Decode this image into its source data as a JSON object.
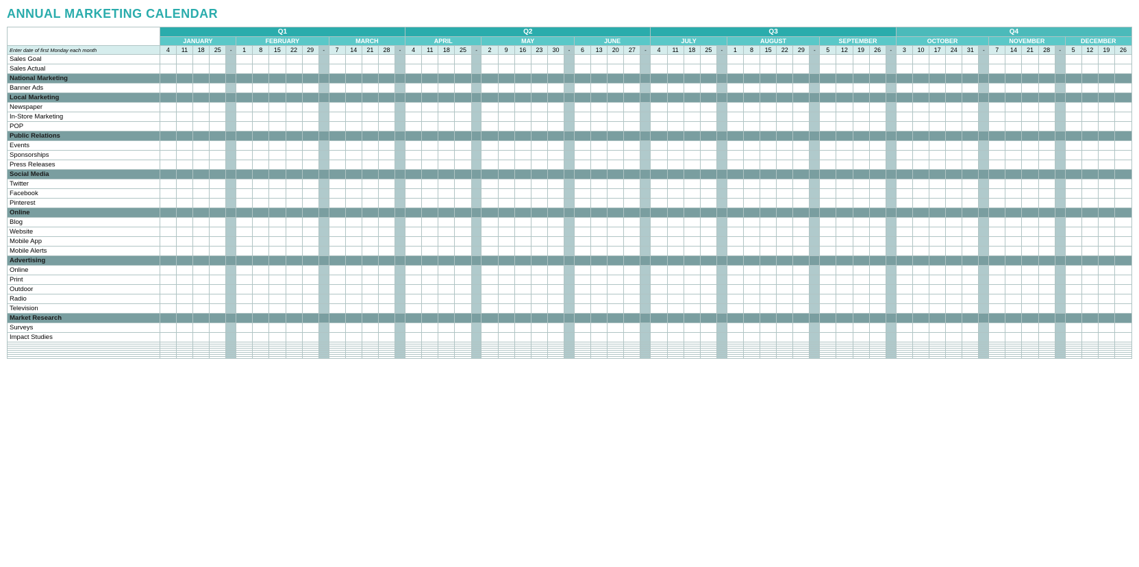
{
  "title": "ANNUAL MARKETING CALENDAR",
  "quarters": [
    {
      "label": "Q1",
      "span": 15,
      "class": "q1-header"
    },
    {
      "label": "Q2",
      "span": 15,
      "class": "q2-header"
    },
    {
      "label": "Q3",
      "span": 15,
      "class": "q3-header"
    },
    {
      "label": "Q4",
      "span": 15,
      "class": "q4-header"
    }
  ],
  "months": [
    {
      "label": "JANUARY",
      "days": [
        4,
        11,
        18,
        25
      ],
      "sep": true
    },
    {
      "label": "FEBRUARY",
      "days": [
        1,
        8,
        15,
        22,
        29
      ],
      "sep": true
    },
    {
      "label": "MARCH",
      "days": [
        7,
        14,
        21,
        28
      ],
      "sep": true
    },
    {
      "label": "APRIL",
      "days": [
        4,
        11,
        18,
        25
      ],
      "sep": true
    },
    {
      "label": "MAY",
      "days": [
        2,
        9,
        16,
        23,
        30
      ],
      "sep": true
    },
    {
      "label": "JUNE",
      "days": [
        6,
        13,
        20,
        27
      ],
      "sep": true
    },
    {
      "label": "JULY",
      "days": [
        4,
        11,
        18,
        25
      ],
      "sep": true
    },
    {
      "label": "AUGUST",
      "days": [
        1,
        8,
        15,
        22,
        29
      ],
      "sep": true
    },
    {
      "label": "SEPTEMBER",
      "days": [
        5,
        12,
        19,
        26
      ],
      "sep": true
    },
    {
      "label": "OCTOBER",
      "days": [
        3,
        10,
        17,
        24,
        31
      ],
      "sep": true
    },
    {
      "label": "NOVEMBER",
      "days": [
        7,
        14,
        21,
        28
      ],
      "sep": true
    },
    {
      "label": "DECEMBER",
      "days": [
        5,
        12,
        19,
        26
      ],
      "sep": false
    }
  ],
  "date_row_label": "Enter date of first Monday each month",
  "rows": [
    {
      "type": "data",
      "label": "Sales Goal"
    },
    {
      "type": "data",
      "label": "Sales Actual"
    },
    {
      "type": "category",
      "label": "National Marketing"
    },
    {
      "type": "data",
      "label": "Banner Ads"
    },
    {
      "type": "category",
      "label": "Local Marketing"
    },
    {
      "type": "data",
      "label": "Newspaper"
    },
    {
      "type": "data",
      "label": "In-Store Marketing"
    },
    {
      "type": "data",
      "label": "POP"
    },
    {
      "type": "category",
      "label": "Public Relations"
    },
    {
      "type": "data",
      "label": "Events"
    },
    {
      "type": "data",
      "label": "Sponsorships"
    },
    {
      "type": "data",
      "label": "Press Releases"
    },
    {
      "type": "category",
      "label": "Social Media"
    },
    {
      "type": "data",
      "label": "Twitter"
    },
    {
      "type": "data",
      "label": "Facebook"
    },
    {
      "type": "data",
      "label": "Pinterest"
    },
    {
      "type": "category",
      "label": "Online"
    },
    {
      "type": "data",
      "label": "Blog"
    },
    {
      "type": "data",
      "label": "Website"
    },
    {
      "type": "data",
      "label": "Mobile App"
    },
    {
      "type": "data",
      "label": "Mobile Alerts"
    },
    {
      "type": "category",
      "label": "Advertising"
    },
    {
      "type": "data",
      "label": "Online"
    },
    {
      "type": "data",
      "label": "Print"
    },
    {
      "type": "data",
      "label": "Outdoor"
    },
    {
      "type": "data",
      "label": "Radio"
    },
    {
      "type": "data",
      "label": "Television"
    },
    {
      "type": "category",
      "label": "Market Research"
    },
    {
      "type": "data",
      "label": "Surveys"
    },
    {
      "type": "data",
      "label": "Impact Studies"
    },
    {
      "type": "empty",
      "label": ""
    },
    {
      "type": "empty",
      "label": ""
    },
    {
      "type": "empty",
      "label": ""
    },
    {
      "type": "empty",
      "label": ""
    },
    {
      "type": "empty",
      "label": ""
    },
    {
      "type": "empty",
      "label": ""
    },
    {
      "type": "empty",
      "label": ""
    },
    {
      "type": "empty",
      "label": ""
    }
  ]
}
